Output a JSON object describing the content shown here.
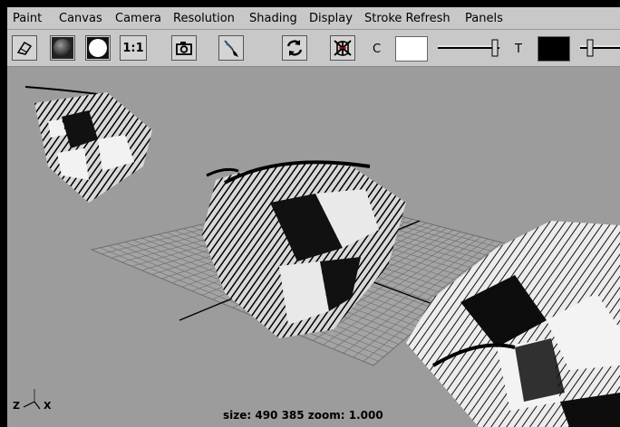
{
  "menubar": {
    "items": [
      "Paint",
      "Canvas",
      "Camera",
      "Resolution",
      "Shading",
      "Display",
      "Stroke Refresh",
      "Panels"
    ]
  },
  "toolbar": {
    "buttons": [
      {
        "name": "eraser",
        "icon": "eraser-icon"
      },
      {
        "name": "shaded-sphere",
        "icon": "shaded-sphere-icon"
      },
      {
        "name": "white-circle",
        "icon": "white-circle-icon"
      },
      {
        "name": "one-to-one",
        "label": "1:1"
      },
      {
        "name": "snapshot",
        "icon": "camera-icon"
      },
      {
        "name": "paint-brush",
        "icon": "paint-brush-icon"
      },
      {
        "name": "refresh",
        "icon": "refresh-icon"
      },
      {
        "name": "hide-strokes",
        "icon": "stroke-mask-icon"
      }
    ],
    "color_label": "C",
    "color_swatch": "#ffffff",
    "transparency_label": "T",
    "transparency_swatch": "#000000"
  },
  "viewport": {
    "status_text": "size:  490  385 zoom: 1.000",
    "axis_z": "Z",
    "axis_x": "X"
  }
}
